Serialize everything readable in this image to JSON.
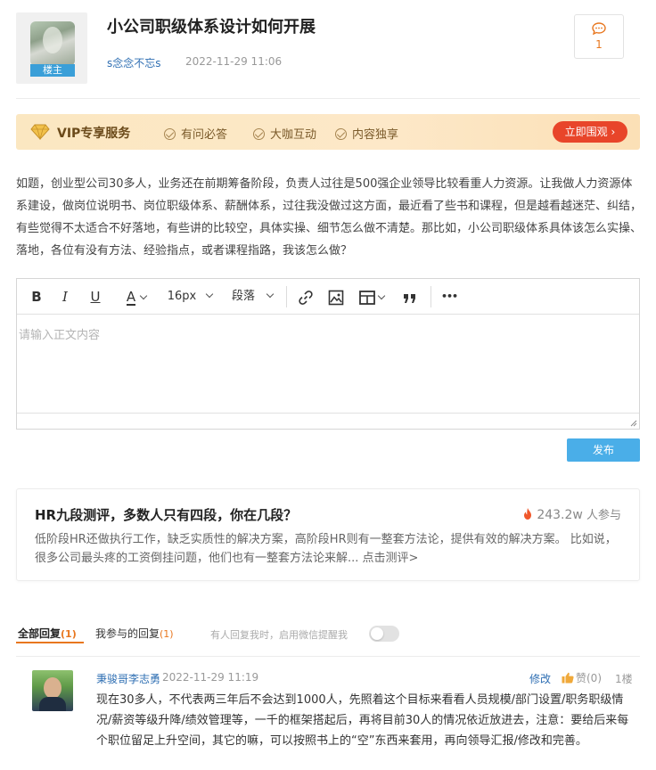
{
  "post": {
    "title": "小公司职级体系设计如何开展",
    "author": "s念念不忘s",
    "time": "2022-11-29 11:06",
    "owner_badge": "楼主",
    "comment_count": "1",
    "body": "如题，创业型公司30多人，业务还在前期筹备阶段，负责人过往是500强企业领导比较看重人力资源。让我做人力资源体系建设，做岗位说明书、岗位职级体系、薪酬体系，过往我没做过这方面，最近看了些书和课程，但是越看越迷茫、纠结，有些觉得不太适合不好落地，有些讲的比较空，具体实操、细节怎么做不清楚。那比如，小公司职级体系具体该怎么实操、落地，各位有没有方法、经验指点，或者课程指路，我该怎么做？"
  },
  "vip": {
    "title": "VIP专享服务",
    "features": [
      "有问必答",
      "大咖互动",
      "内容独享"
    ],
    "button": "立即围观",
    "button_arrow": "›"
  },
  "editor": {
    "bold": "B",
    "italic": "I",
    "underline": "U",
    "font_color": "A",
    "font_size": "16px",
    "paragraph": "段落",
    "placeholder": "请输入正文内容",
    "more": "•••"
  },
  "publish_label": "发布",
  "promo": {
    "title": "HR九段测评，多数人只有四段，你在几段？",
    "count": "243.2w",
    "count_suffix": "人参与",
    "desc": "低阶段HR还做执行工作，缺乏实质性的解决方案，高阶段HR则有一整套方法论，提供有效的解决方案。 比如说，很多公司最头疼的工资倒挂问题，他们也有一整套方法论来解... 点击测评>"
  },
  "reply_tabs": {
    "all_label": "全部回复",
    "all_count": "(1)",
    "mine_label": "我参与的回复",
    "mine_count": "(1)",
    "hint": "有人回复我时，启用微信提醒我"
  },
  "replies": [
    {
      "user": "秉骏哥李志勇",
      "time": "2022-11-29 11:19",
      "edit": "修改",
      "like": "赞(0)",
      "floor": "1楼",
      "text": "现在30多人，不代表两三年后不会达到1000人，先照着这个目标来看看人员规模/部门设置/职务职级情况/薪资等级升降/绩效管理等，一千的框架搭起后，再将目前30人的情况依近放进去，注意：要给后来每个职位留足上升空间，其它的嘛，可以按照书上的“空”东西来套用，再向领导汇报/修改和完善。"
    }
  ],
  "colors": {
    "accent": "#e8771f",
    "link": "#2f6fb3",
    "publish": "#4aaee8",
    "vip_button": "#e8452a",
    "badge": "#3a9fd8"
  }
}
